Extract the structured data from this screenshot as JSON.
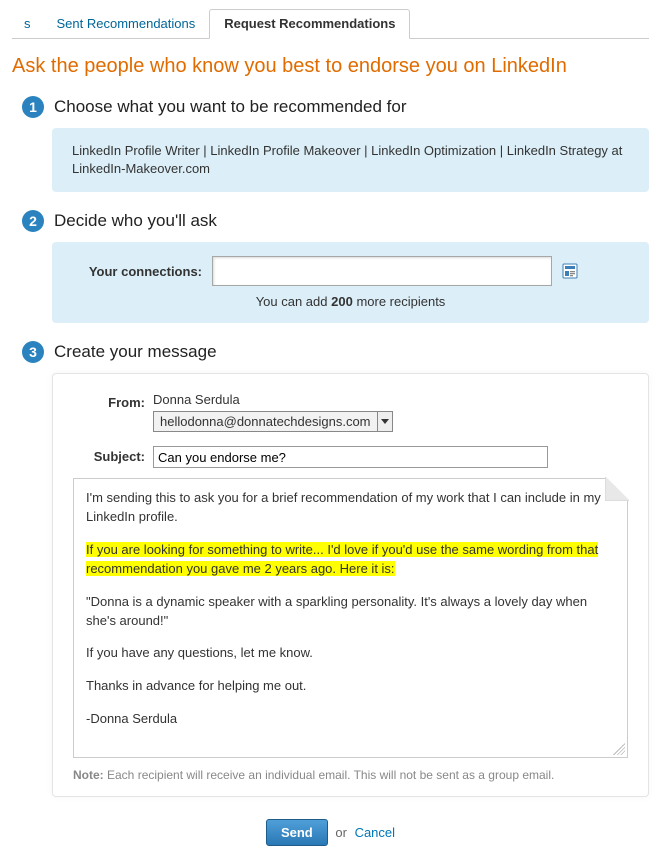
{
  "tabs": {
    "s": "s",
    "sent": "Sent Recommendations",
    "request": "Request Recommendations"
  },
  "headline": "Ask the people who know you best to endorse you on LinkedIn",
  "step1": {
    "num": "1",
    "title": "Choose what you want to be recommended for",
    "job": "LinkedIn Profile Writer | LinkedIn Profile Makeover | LinkedIn Optimization | LinkedIn Strategy at LinkedIn-Makeover.com"
  },
  "step2": {
    "num": "2",
    "title": "Decide who you'll ask",
    "label": "Your connections:",
    "input_value": "",
    "recip_pre": "You can add ",
    "recip_count": "200",
    "recip_post": " more recipients"
  },
  "step3": {
    "num": "3",
    "title": "Create your message",
    "from_label": "From:",
    "from_name": "Donna Serdula",
    "from_email": "hellodonna@donnatechdesigns.com",
    "subject_label": "Subject:",
    "subject_value": "Can you endorse me?",
    "msg_p1": "I'm sending this to ask you for a brief recommendation of my work that I can include in my LinkedIn profile.",
    "msg_hl1": "If you are looking for something to write... I'd love if you'd use the same wording from that recommendation you gave me 2 years ago.  Here it is:",
    "msg_p3": "\"Donna is a dynamic speaker with a sparkling personality. It's always a lovely day when she's around!\"",
    "msg_p4": "If you have any questions, let me know.",
    "msg_p5": "Thanks in advance for helping me out.",
    "msg_p6": "-Donna Serdula",
    "note_label": "Note:",
    "note_text": " Each recipient will receive an individual email. This will not be sent as a group email."
  },
  "actions": {
    "send": "Send",
    "or": " or ",
    "cancel": "Cancel"
  }
}
